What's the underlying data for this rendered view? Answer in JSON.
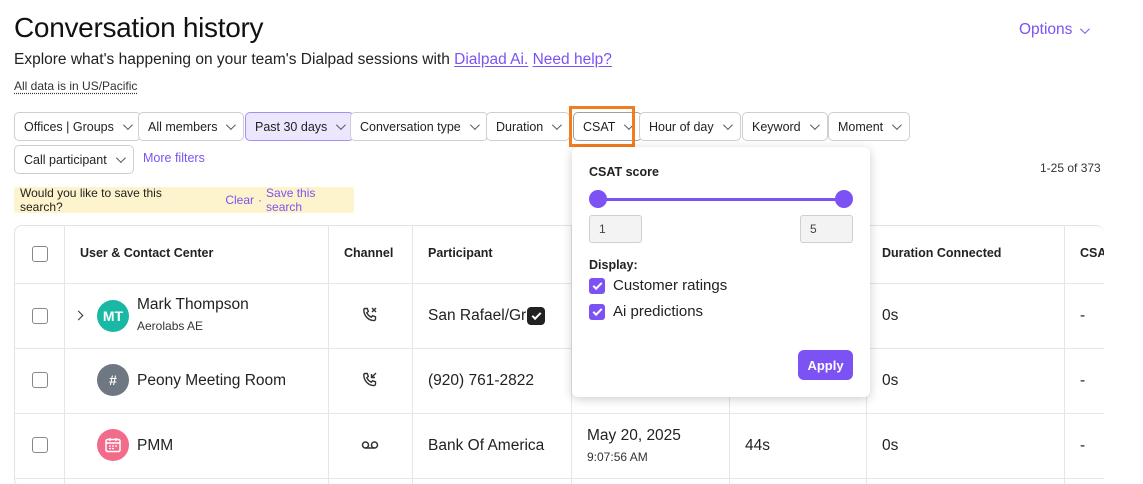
{
  "header": {
    "title": "Conversation history",
    "subtitle_prefix": "Explore what's happening on your team's Dialpad sessions with ",
    "link_ai": "Dialpad Ai.",
    "link_help": "Need help?",
    "timezone_note": "All data is in US/Pacific",
    "options_label": "Options"
  },
  "filters": {
    "offices": "Offices | Groups",
    "members": "All members",
    "date_range": "Past 30 days",
    "conversation_type": "Conversation type",
    "duration": "Duration",
    "csat": "CSAT",
    "hour_of_day": "Hour of day",
    "keyword": "Keyword",
    "moment": "Moment",
    "call_participant": "Call participant",
    "more_filters": "More filters"
  },
  "save_search": {
    "question": "Would you like to save this search?",
    "clear": "Clear",
    "separator": "·",
    "save": "Save this search"
  },
  "pagination": {
    "range": "1-25 of 373"
  },
  "table": {
    "headers": {
      "user": "User & Contact Center",
      "channel": "Channel",
      "participant": "Participant",
      "duration_connected": "Duration Connected",
      "csat": "CSA"
    },
    "rows": [
      {
        "name": "Mark Thompson",
        "sub": "Aerolabs AE",
        "initials": "MT",
        "avatar_color": "#19b8a5",
        "channel_icon": "missed-call-icon",
        "participant": "San Rafael/Gr",
        "date": "",
        "time": "",
        "duration": "",
        "connected": "0s",
        "csat": "-"
      },
      {
        "name": "Peony Meeting Room",
        "sub": "",
        "initials": "#",
        "avatar_color": "#6f7782",
        "channel_icon": "incoming-call-icon",
        "participant": "(920) 761-2822",
        "date": "",
        "time": "",
        "duration": "",
        "connected": "0s",
        "csat": "-"
      },
      {
        "name": "PMM",
        "sub": "",
        "initials": "",
        "avatar_color": "#f26b8a",
        "channel_icon": "voicemail-icon",
        "participant": "Bank Of America",
        "date": "May 20, 2025",
        "time": "9:07:56 AM",
        "duration": "44s",
        "connected": "0s",
        "csat": "-"
      }
    ]
  },
  "csat_dropdown": {
    "score_label": "CSAT score",
    "min": "1",
    "max": "5",
    "display_label": "Display:",
    "option_customer": "Customer ratings",
    "option_ai": "Ai predictions",
    "apply": "Apply"
  },
  "colors": {
    "accent": "#7c52f4",
    "highlight": "#f47c20",
    "save_bar": "#fdf3cc"
  }
}
